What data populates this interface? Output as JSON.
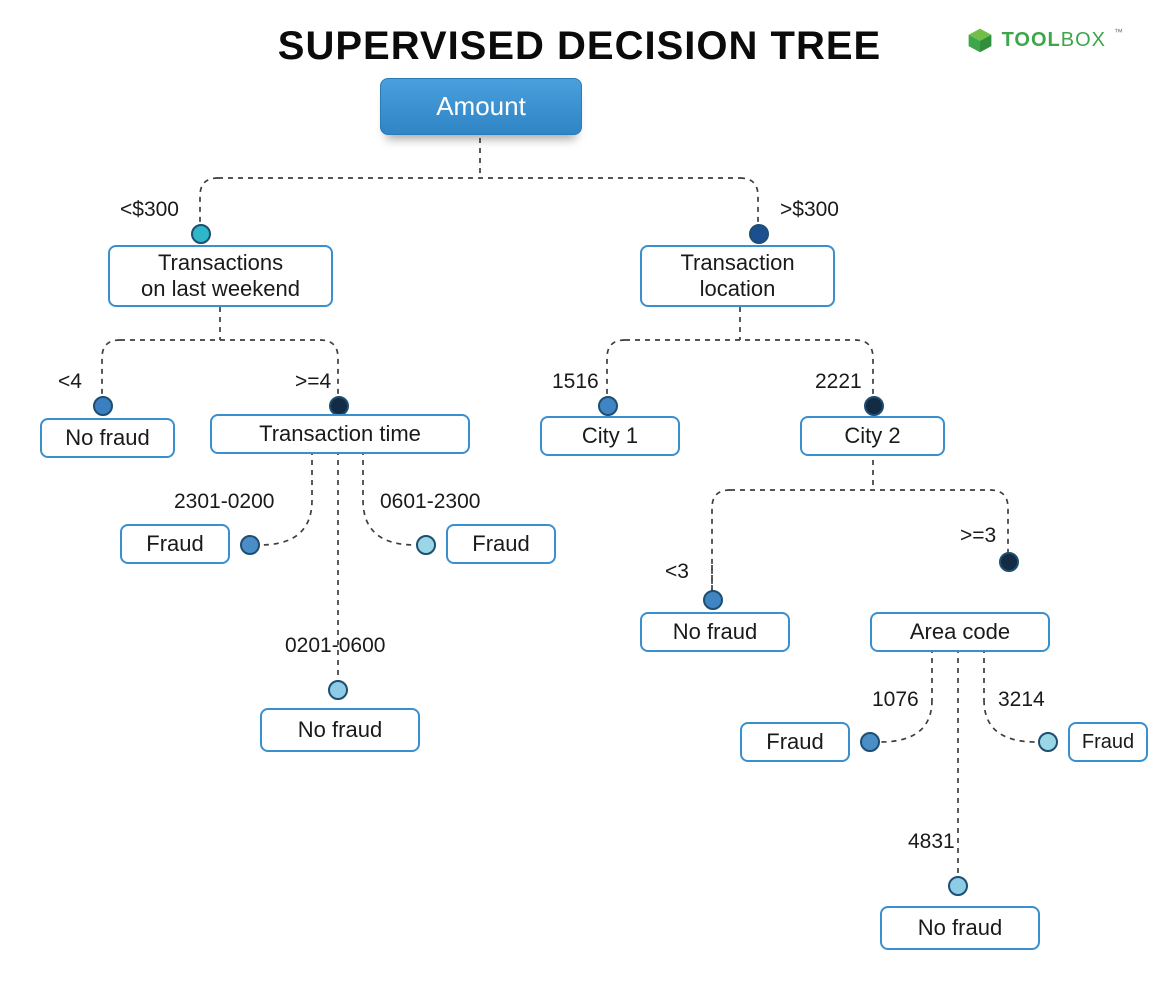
{
  "title": "SUPERVISED DECISION TREE",
  "logo": {
    "word1": "TOOL",
    "word2": "BOX",
    "tm": "™"
  },
  "root": "Amount",
  "edges": {
    "root_left": "<$300",
    "root_right": ">$300",
    "tx_lt4": "<4",
    "tx_ge4": ">=4",
    "time_a": "2301-0200",
    "time_b": "0601-2300",
    "time_c": "0201-0600",
    "loc_a": "1516",
    "loc_b": "2221",
    "city2_lt3": "<3",
    "city2_ge3": ">=3",
    "area_a": "1076",
    "area_b": "3214",
    "area_c": "4831"
  },
  "nodes": {
    "tx_weekend": "Transactions\non last weekend",
    "tx_location": "Transaction\nlocation",
    "no_fraud": "No fraud",
    "tx_time": "Transaction time",
    "fraud": "Fraud",
    "city1": "City 1",
    "city2": "City 2",
    "area_code": "Area code"
  }
}
